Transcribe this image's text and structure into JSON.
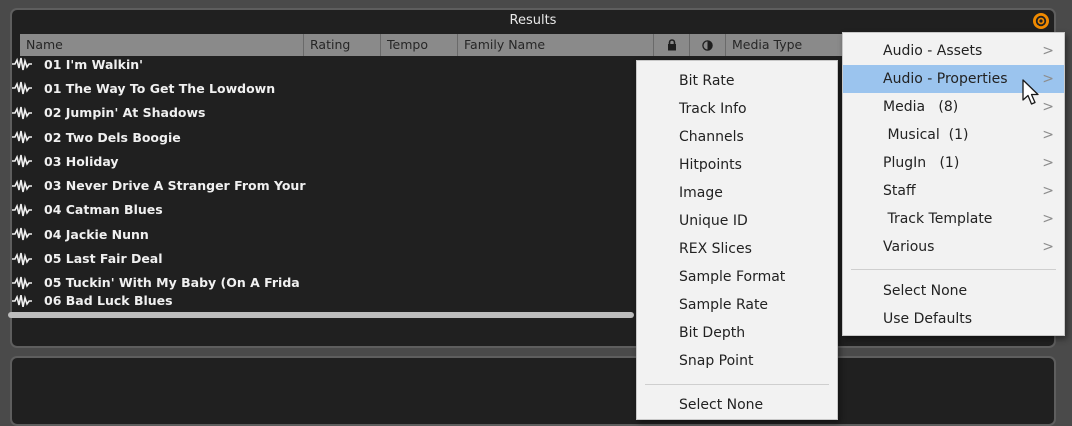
{
  "panel": {
    "title": "Results"
  },
  "columns": [
    {
      "label": "Name"
    },
    {
      "label": "Rating"
    },
    {
      "label": "Tempo"
    },
    {
      "label": "Family Name"
    },
    {
      "label": "",
      "icon": "lock-icon"
    },
    {
      "label": "",
      "icon": "contrast-icon"
    },
    {
      "label": "Media Type"
    }
  ],
  "rows": [
    "01 I'm Walkin'",
    "01 The Way To Get The Lowdown",
    "02 Jumpin' At Shadows",
    "02 Two Dels Boogie",
    "03 Holiday",
    "03 Never Drive A Stranger From Your",
    "04 Catman Blues",
    "04 Jackie Nunn",
    "05 Last Fair Deal",
    "05 Tuckin' With My Baby (On A Frida",
    "06 Bad Luck Blues"
  ],
  "submenu": {
    "items": [
      "Bit Rate",
      "Track Info",
      "Channels",
      "Hitpoints",
      "Image",
      "Unique ID",
      "REX Slices",
      "Sample Format",
      "Sample Rate",
      "Bit Depth",
      "Snap Point"
    ],
    "select_none": "Select None"
  },
  "main_menu": {
    "items": [
      {
        "label": "Audio - Assets",
        "arrow": ">"
      },
      {
        "label": "Audio - Properties",
        "arrow": ">"
      },
      {
        "label": "Media   (8)",
        "arrow": ">"
      },
      {
        "label": " Musical  (1)",
        "arrow": ">"
      },
      {
        "label": "PlugIn   (1)",
        "arrow": ">"
      },
      {
        "label": "Staff",
        "arrow": ">"
      },
      {
        "label": " Track Template",
        "arrow": ">"
      },
      {
        "label": "Various",
        "arrow": ">"
      }
    ],
    "select_none": "Select None",
    "use_defaults": "Use Defaults"
  },
  "colors": {
    "gear_accent": "#f08a00",
    "highlight": "#9bc4ee"
  }
}
